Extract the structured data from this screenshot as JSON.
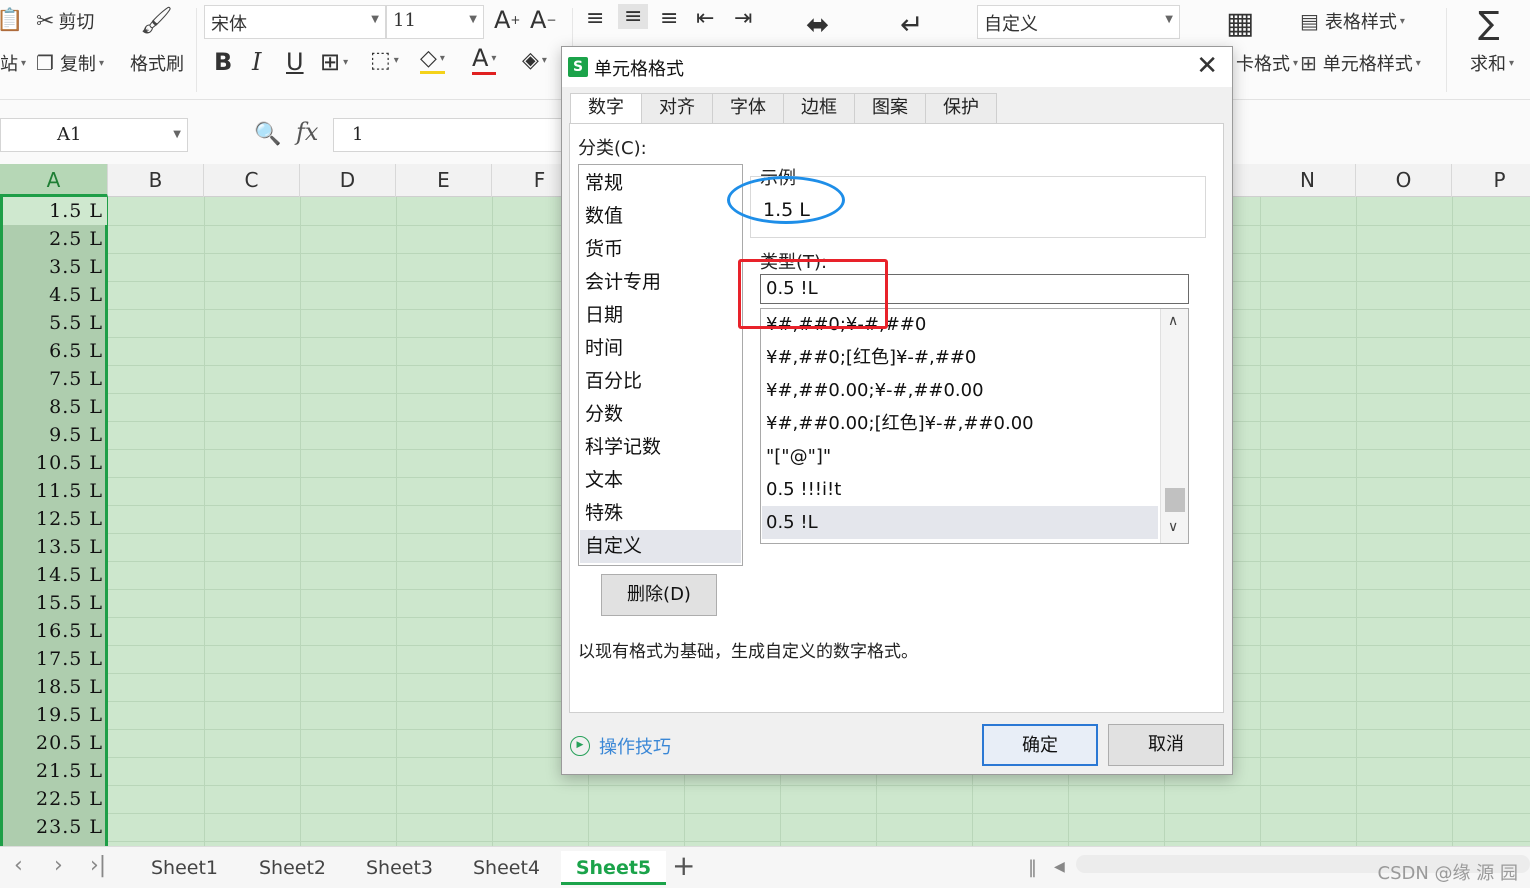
{
  "ribbon": {
    "cut": "剪切",
    "copy": "复制",
    "paste_partial": "站",
    "format_painter": "格式刷",
    "font_name": "宋体",
    "font_size": "11",
    "number_format": "自定义",
    "table_style": "表格样式",
    "cell_style": "单元格样式",
    "cond_format_partial": "卡格式",
    "sum": "求和"
  },
  "formula_bar": {
    "name_box": "A1",
    "fx": "fx",
    "content": "1"
  },
  "columns": [
    "A",
    "B",
    "C",
    "D",
    "E",
    "F",
    "N",
    "O",
    "P"
  ],
  "cells_A": [
    "1.5 L",
    "2.5 L",
    "3.5 L",
    "4.5 L",
    "5.5 L",
    "6.5 L",
    "7.5 L",
    "8.5 L",
    "9.5 L",
    "10.5 L",
    "11.5 L",
    "12.5 L",
    "13.5 L",
    "14.5 L",
    "15.5 L",
    "16.5 L",
    "17.5 L",
    "18.5 L",
    "19.5 L",
    "20.5 L",
    "21.5 L",
    "22.5 L",
    "23.5 L"
  ],
  "sheet_tabs": [
    "Sheet1",
    "Sheet2",
    "Sheet3",
    "Sheet4",
    "Sheet5"
  ],
  "active_sheet": "Sheet5",
  "watermark": "CSDN @缘 源 园",
  "dialog": {
    "title": "单元格格式",
    "tabs": [
      "数字",
      "对齐",
      "字体",
      "边框",
      "图案",
      "保护"
    ],
    "category_label": "分类(C):",
    "categories": [
      "常规",
      "数值",
      "货币",
      "会计专用",
      "日期",
      "时间",
      "百分比",
      "分数",
      "科学记数",
      "文本",
      "特殊",
      "自定义"
    ],
    "selected_category": "自定义",
    "sample_label": "示例",
    "sample_value": "1.5 L",
    "type_label": "类型(T):",
    "type_value": "0.5 !L",
    "type_list": [
      "¥#,##0;¥-#,##0",
      "¥#,##0;[红色]¥-#,##0",
      "¥#,##0.00;¥-#,##0.00",
      "¥#,##0.00;[红色]¥-#,##0.00",
      "\"[\"@\"]\"",
      "0.5 !!!i!t",
      "0.5 !L"
    ],
    "delete_button": "删除(D)",
    "description": "以现有格式为基础，生成自定义的数字格式。",
    "tips": "操作技巧",
    "ok": "确定",
    "cancel": "取消"
  },
  "colors": {
    "accent_green": "#1ba34a",
    "grid_bg": "#cde7cd",
    "annotation_blue": "#1e8ee8",
    "annotation_red": "#e8222a"
  }
}
